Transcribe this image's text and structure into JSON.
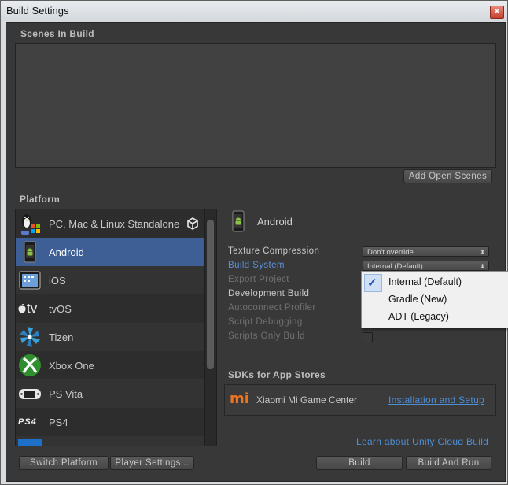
{
  "window": {
    "title": "Build Settings",
    "close_glyph": "✕"
  },
  "scenes": {
    "label": "Scenes In Build",
    "add_open_scenes": "Add Open Scenes"
  },
  "platform": {
    "label": "Platform",
    "items": [
      {
        "name": "PC, Mac & Linux Standalone",
        "icon": "pc-mac-linux-icon"
      },
      {
        "name": "Android",
        "icon": "android-icon",
        "selected": true
      },
      {
        "name": "iOS",
        "icon": "ios-icon"
      },
      {
        "name": "tvOS",
        "icon": "tvos-icon"
      },
      {
        "name": "Tizen",
        "icon": "tizen-icon"
      },
      {
        "name": "Xbox One",
        "icon": "xbox-icon"
      },
      {
        "name": "PS Vita",
        "icon": "ps-vita-icon"
      },
      {
        "name": "PS4",
        "icon": "ps4-icon"
      }
    ],
    "tvos_glyph": "tv",
    "ps4_glyph": "PS4"
  },
  "settings": {
    "platform_title": "Android",
    "texture_compression": {
      "label": "Texture Compression",
      "value": "Don't override"
    },
    "build_system": {
      "label": "Build System",
      "value": "Internal (Default)"
    },
    "export_project": "Export Project",
    "development_build": "Development Build",
    "autoconnect_profiler": "Autoconnect Profiler",
    "script_debugging": "Script Debugging",
    "scripts_only_build": "Scripts Only Build",
    "dropdown_arrow": "⬍"
  },
  "build_system_menu": {
    "options": [
      "Internal (Default)",
      "Gradle (New)",
      "ADT (Legacy)"
    ],
    "checked": "Internal (Default)",
    "check_glyph": "✓"
  },
  "sdks": {
    "label": "SDKs for App Stores",
    "item": "Xiaomi Mi Game Center",
    "link": "Installation and Setup",
    "logo_text": "mi"
  },
  "footer": {
    "cloud_link": "Learn about Unity Cloud Build",
    "switch_platform": "Switch Platform",
    "player_settings": "Player Settings...",
    "build": "Build",
    "build_and_run": "Build And Run"
  },
  "colors": {
    "panel_bg": "#383838",
    "selected_row": "#3e5f96",
    "link": "#4d8fd8",
    "build_system_label": "#5b8fd6",
    "disabled_text": "#707070"
  }
}
